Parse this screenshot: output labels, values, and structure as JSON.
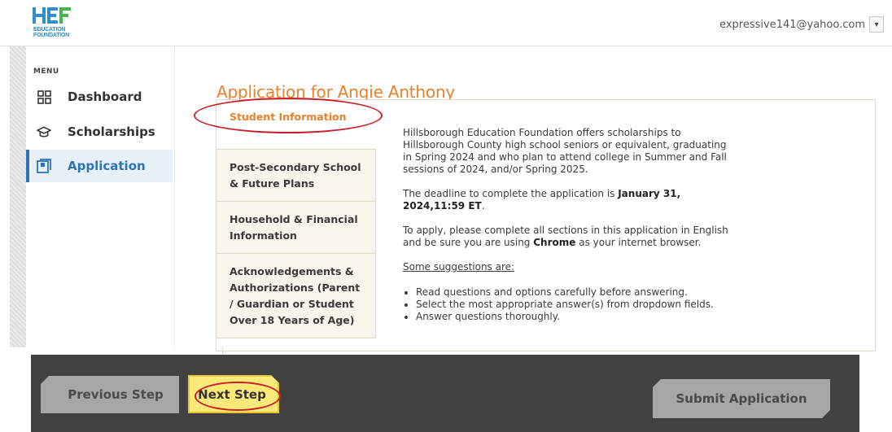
{
  "header": {
    "logo": {
      "mark_text": "HEF",
      "line1": "EDUCATION",
      "line2": "FOUNDATION",
      "colors": {
        "h": "#2f8fc8",
        "e": "#2f8fc8",
        "f": "#43b749"
      }
    },
    "account_email": "expressive141@yahoo.com",
    "account_caret": "▾"
  },
  "sidebar": {
    "menu_label": "MENU",
    "items": [
      {
        "label": "Dashboard",
        "icon": "dashboard-grid-icon",
        "active": false
      },
      {
        "label": "Scholarships",
        "icon": "graduation-cap-icon",
        "active": false
      },
      {
        "label": "Application",
        "icon": "application-form-icon",
        "active": true
      }
    ]
  },
  "main": {
    "title": "Application for Angie Anthony",
    "steps": [
      {
        "label": "Student Information",
        "active": true
      },
      {
        "label": "Post-Secondary School & Future Plans",
        "active": false
      },
      {
        "label": "Household & Financial Information",
        "active": false
      },
      {
        "label": "Acknowledgements & Authorizations (Parent / Guardian or Student Over 18 Years of Age)",
        "active": false
      }
    ],
    "content": {
      "intro": "Hillsborough Education Foundation offers scholarships to Hillsborough County high school seniors or equivalent, graduating in Spring 2024 and who plan to attend college in Summer and Fall sessions of 2024, and/or Spring 2025.",
      "deadline_prefix": "The deadline to complete the application is ",
      "deadline_value": "January 31, 2024,11:59 ET",
      "deadline_suffix": ".",
      "apply_prefix": "To apply, please complete all sections in this application in English and be sure you are using ",
      "apply_browser": "Chrome",
      "apply_suffix": " as your internet browser.",
      "suggestions_heading": "Some suggestions are:",
      "suggestions": [
        "Read questions and options carefully before answering.",
        "Select the most appropriate answer(s) from dropdown fields.",
        "Answer questions thoroughly."
      ]
    }
  },
  "footer": {
    "previous_label": "Previous Step",
    "next_label": "Next Step",
    "submit_label": "Submit Application"
  },
  "colors": {
    "accent_orange": "#e9822e",
    "nav_active_blue": "#2d73b9",
    "footer_bg": "#414141",
    "next_button": "#fbe97a",
    "disabled_button": "#a6a6a6",
    "annotation_red": "#c8202a"
  }
}
